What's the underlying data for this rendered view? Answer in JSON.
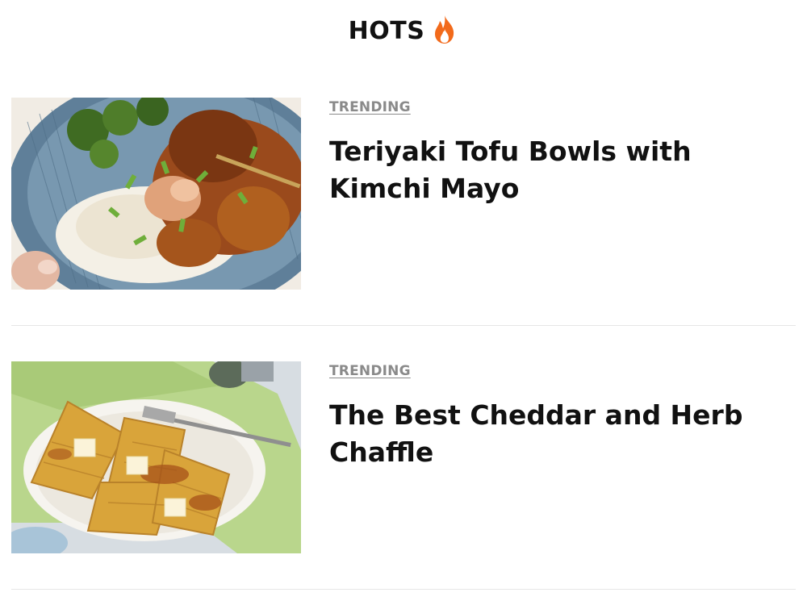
{
  "header": {
    "title": "HOTS",
    "icon": "flame-icon",
    "icon_color": "#f26a1b"
  },
  "cards": [
    {
      "tag": "TRENDING",
      "title": "Teriyaki Tofu Bowls with Kimchi Mayo",
      "image": "tofu-bowl-photo"
    },
    {
      "tag": "TRENDING",
      "title": "The Best Cheddar and Herb Chaffle",
      "image": "chaffle-photo"
    }
  ],
  "colors": {
    "tag": "#8a8a8a",
    "title": "#111111",
    "divider": "#e6e6e6"
  }
}
